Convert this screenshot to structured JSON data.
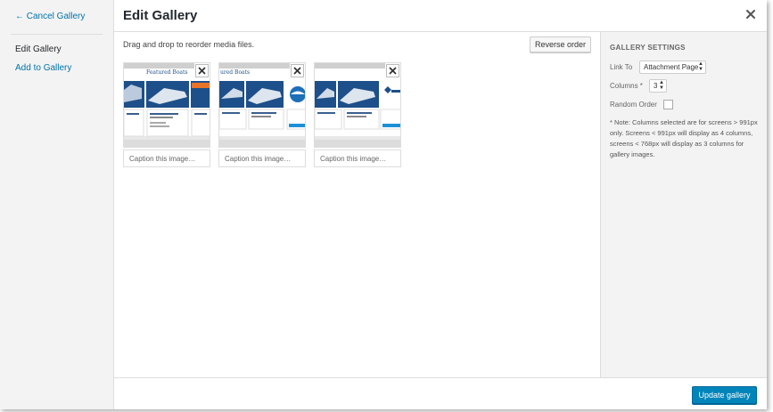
{
  "sidebar": {
    "cancel_label": "← Cancel Gallery",
    "menu": [
      {
        "label": "Edit Gallery",
        "active": true
      },
      {
        "label": "Add to Gallery",
        "active": false
      }
    ]
  },
  "header": {
    "title": "Edit Gallery"
  },
  "content": {
    "instructions": "Drag and drop to reorder media files.",
    "reverse_label": "Reverse order",
    "items": [
      {
        "thumb_banner": "Featured Boats",
        "caption_placeholder": "Caption this image…"
      },
      {
        "thumb_banner": "ured Boats",
        "caption_placeholder": "Caption this image…"
      },
      {
        "thumb_banner": "",
        "caption_placeholder": "Caption this image…"
      }
    ]
  },
  "settings": {
    "heading": "GALLERY SETTINGS",
    "link_to_label": "Link To",
    "link_to_value": "Attachment Page",
    "columns_label": "Columns *",
    "columns_value": "3",
    "random_label": "Random Order",
    "random_checked": false,
    "note": "* Note: Columns selected are for screens > 991px only. Screens < 991px will display as 4 columns, screens < 768px will display as 3 columns for gallery images."
  },
  "footer": {
    "update_label": "Update gallery"
  },
  "colors": {
    "primary": "#0085ba",
    "link": "#0073aa",
    "panel": "#f3f3f3"
  }
}
